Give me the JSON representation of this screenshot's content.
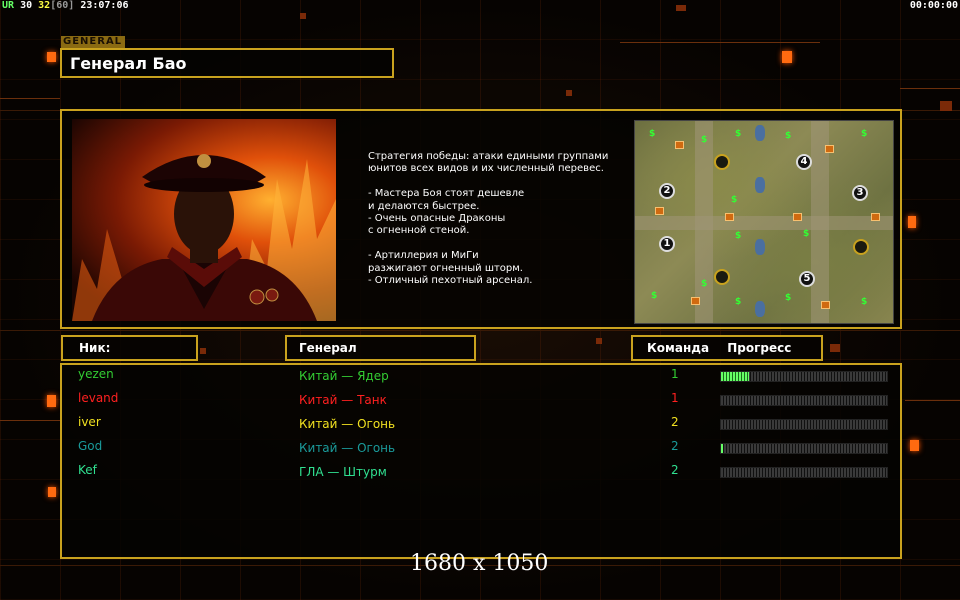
{
  "status_bar": {
    "left_tag": "UR",
    "fps": "30",
    "fps_cap": "32",
    "fps_max": "[60]",
    "clock": "23:07:06",
    "timer": "00:00:00"
  },
  "general": {
    "tag": "GENERAL",
    "name": "Генерал Бао"
  },
  "strategy_lines": [
    "Стратегия победы: атаки едиными группами",
    "юнитов всех видов и их численный перевес.",
    "",
    "- Мастера Боя стоят дешевле",
    "и делаются быстрее.",
    "- Очень опасные Драконы",
    "с огненной стеной.",
    "",
    "- Артиллерия и МиГи",
    "разжигают огненный шторм.",
    "- Отличный пехотный арсенал."
  ],
  "map": {
    "start_positions": [
      "1",
      "2",
      "3",
      "4",
      "5"
    ]
  },
  "table": {
    "header_nick": "Ник:",
    "header_general": "Генерал",
    "header_team": "Команда",
    "header_progress": "Прогресс",
    "players": [
      {
        "nick": "yezen",
        "general": "Китай — Ядер",
        "team": "1",
        "progress": 0.17,
        "color": "#33cc33"
      },
      {
        "nick": "levand",
        "general": "Китай — Танк",
        "team": "1",
        "progress": 0.0,
        "color": "#ff2020"
      },
      {
        "nick": "iver",
        "general": "Китай — Огонь",
        "team": "2",
        "progress": 0.0,
        "color": "#f0e020"
      },
      {
        "nick": "God",
        "general": "Китай — Огонь",
        "team": "2",
        "progress": 0.01,
        "color": "#1a9a9a"
      },
      {
        "nick": "Kef",
        "general": "ГЛА — Штурм",
        "team": "2",
        "progress": 0.0,
        "color": "#30e090"
      }
    ]
  },
  "watermark": "1680 x 1050"
}
